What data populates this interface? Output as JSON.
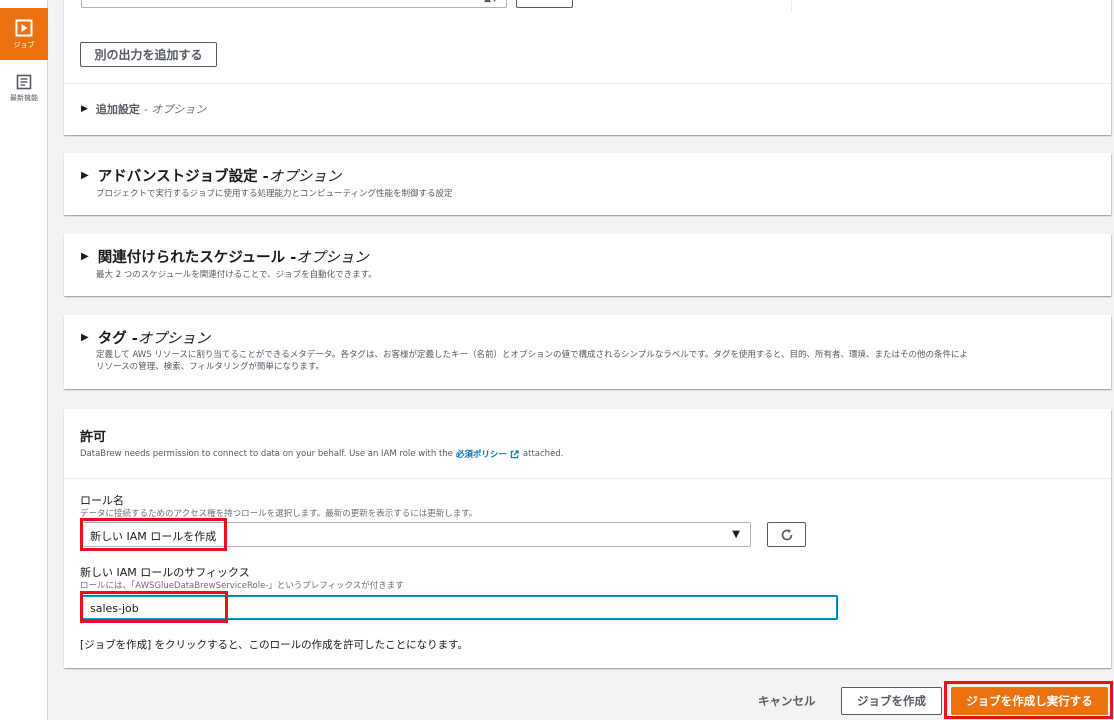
{
  "nav": {
    "jobs_label": "ジョブ",
    "news_label": "最新機能"
  },
  "output": {
    "add_output_button": "別の出力を追加する",
    "additional_settings_title": "追加設定",
    "additional_settings_optional": "- オプション"
  },
  "advanced": {
    "title": "アドバンストジョブ設定 -",
    "optional": "オプション",
    "description": "プロジェクトで実行するジョブに使用する処理能力とコンピューティング性能を制御する設定"
  },
  "schedules": {
    "title": "関連付けられたスケジュール -",
    "optional": "オプション",
    "description": "最大 2 つのスケジュールを関連付けることで、ジョブを自動化できます。"
  },
  "tags": {
    "title": "タグ -",
    "optional": "オプション",
    "description_line1": "定義して AWS リソースに割り当てることができるメタデータ。各タグは、お客様が定義したキー（名前）とオプションの値で構成されるシンプルなラベルです。タグを使用すると、目的、所有者、環境、またはその他の条件によ",
    "description_line2": "リソースの管理、検索、フィルタリングが簡単になります。"
  },
  "permissions": {
    "title": "許可",
    "desc_before": "DataBrew needs permission to connect to data on your behalf. Use an IAM role with the",
    "desc_link": "必須ポリシー",
    "desc_after": "attached.",
    "role_label": "ロール名",
    "role_hint": "データに接続するためのアクセス権を持つロールを選択します。最新の更新を表示するには更新します。",
    "role_selected": "新しい IAM ロールを作成",
    "suffix_label": "新しい IAM ロールのサフィックス",
    "suffix_hint": "ロールには、「AWSGlueDataBrewServiceRole-」というプレフィックスが付きます",
    "suffix_value": "sales-job",
    "consent": "[ジョブを作成] をクリックすると、このロールの作成を許可したことになります。"
  },
  "footer": {
    "cancel": "キャンセル",
    "create": "ジョブを作成",
    "create_and_run": "ジョブを作成し実行する"
  },
  "colors": {
    "accent": "#ec7211",
    "link": "#0073bb",
    "highlight": "#e8101a"
  }
}
